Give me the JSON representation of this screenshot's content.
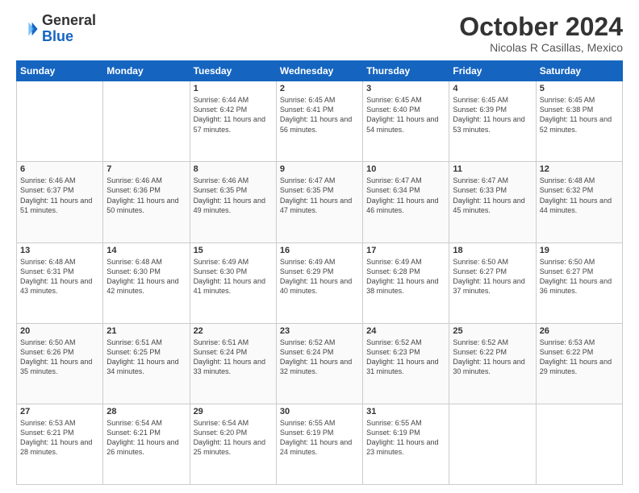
{
  "header": {
    "logo_general": "General",
    "logo_blue": "Blue",
    "month_title": "October 2024",
    "subtitle": "Nicolas R Casillas, Mexico"
  },
  "weekdays": [
    "Sunday",
    "Monday",
    "Tuesday",
    "Wednesday",
    "Thursday",
    "Friday",
    "Saturday"
  ],
  "weeks": [
    [
      {
        "day": "",
        "info": ""
      },
      {
        "day": "",
        "info": ""
      },
      {
        "day": "1",
        "info": "Sunrise: 6:44 AM\nSunset: 6:42 PM\nDaylight: 11 hours and 57 minutes."
      },
      {
        "day": "2",
        "info": "Sunrise: 6:45 AM\nSunset: 6:41 PM\nDaylight: 11 hours and 56 minutes."
      },
      {
        "day": "3",
        "info": "Sunrise: 6:45 AM\nSunset: 6:40 PM\nDaylight: 11 hours and 54 minutes."
      },
      {
        "day": "4",
        "info": "Sunrise: 6:45 AM\nSunset: 6:39 PM\nDaylight: 11 hours and 53 minutes."
      },
      {
        "day": "5",
        "info": "Sunrise: 6:45 AM\nSunset: 6:38 PM\nDaylight: 11 hours and 52 minutes."
      }
    ],
    [
      {
        "day": "6",
        "info": "Sunrise: 6:46 AM\nSunset: 6:37 PM\nDaylight: 11 hours and 51 minutes."
      },
      {
        "day": "7",
        "info": "Sunrise: 6:46 AM\nSunset: 6:36 PM\nDaylight: 11 hours and 50 minutes."
      },
      {
        "day": "8",
        "info": "Sunrise: 6:46 AM\nSunset: 6:35 PM\nDaylight: 11 hours and 49 minutes."
      },
      {
        "day": "9",
        "info": "Sunrise: 6:47 AM\nSunset: 6:35 PM\nDaylight: 11 hours and 47 minutes."
      },
      {
        "day": "10",
        "info": "Sunrise: 6:47 AM\nSunset: 6:34 PM\nDaylight: 11 hours and 46 minutes."
      },
      {
        "day": "11",
        "info": "Sunrise: 6:47 AM\nSunset: 6:33 PM\nDaylight: 11 hours and 45 minutes."
      },
      {
        "day": "12",
        "info": "Sunrise: 6:48 AM\nSunset: 6:32 PM\nDaylight: 11 hours and 44 minutes."
      }
    ],
    [
      {
        "day": "13",
        "info": "Sunrise: 6:48 AM\nSunset: 6:31 PM\nDaylight: 11 hours and 43 minutes."
      },
      {
        "day": "14",
        "info": "Sunrise: 6:48 AM\nSunset: 6:30 PM\nDaylight: 11 hours and 42 minutes."
      },
      {
        "day": "15",
        "info": "Sunrise: 6:49 AM\nSunset: 6:30 PM\nDaylight: 11 hours and 41 minutes."
      },
      {
        "day": "16",
        "info": "Sunrise: 6:49 AM\nSunset: 6:29 PM\nDaylight: 11 hours and 40 minutes."
      },
      {
        "day": "17",
        "info": "Sunrise: 6:49 AM\nSunset: 6:28 PM\nDaylight: 11 hours and 38 minutes."
      },
      {
        "day": "18",
        "info": "Sunrise: 6:50 AM\nSunset: 6:27 PM\nDaylight: 11 hours and 37 minutes."
      },
      {
        "day": "19",
        "info": "Sunrise: 6:50 AM\nSunset: 6:27 PM\nDaylight: 11 hours and 36 minutes."
      }
    ],
    [
      {
        "day": "20",
        "info": "Sunrise: 6:50 AM\nSunset: 6:26 PM\nDaylight: 11 hours and 35 minutes."
      },
      {
        "day": "21",
        "info": "Sunrise: 6:51 AM\nSunset: 6:25 PM\nDaylight: 11 hours and 34 minutes."
      },
      {
        "day": "22",
        "info": "Sunrise: 6:51 AM\nSunset: 6:24 PM\nDaylight: 11 hours and 33 minutes."
      },
      {
        "day": "23",
        "info": "Sunrise: 6:52 AM\nSunset: 6:24 PM\nDaylight: 11 hours and 32 minutes."
      },
      {
        "day": "24",
        "info": "Sunrise: 6:52 AM\nSunset: 6:23 PM\nDaylight: 11 hours and 31 minutes."
      },
      {
        "day": "25",
        "info": "Sunrise: 6:52 AM\nSunset: 6:22 PM\nDaylight: 11 hours and 30 minutes."
      },
      {
        "day": "26",
        "info": "Sunrise: 6:53 AM\nSunset: 6:22 PM\nDaylight: 11 hours and 29 minutes."
      }
    ],
    [
      {
        "day": "27",
        "info": "Sunrise: 6:53 AM\nSunset: 6:21 PM\nDaylight: 11 hours and 28 minutes."
      },
      {
        "day": "28",
        "info": "Sunrise: 6:54 AM\nSunset: 6:21 PM\nDaylight: 11 hours and 26 minutes."
      },
      {
        "day": "29",
        "info": "Sunrise: 6:54 AM\nSunset: 6:20 PM\nDaylight: 11 hours and 25 minutes."
      },
      {
        "day": "30",
        "info": "Sunrise: 6:55 AM\nSunset: 6:19 PM\nDaylight: 11 hours and 24 minutes."
      },
      {
        "day": "31",
        "info": "Sunrise: 6:55 AM\nSunset: 6:19 PM\nDaylight: 11 hours and 23 minutes."
      },
      {
        "day": "",
        "info": ""
      },
      {
        "day": "",
        "info": ""
      }
    ]
  ]
}
